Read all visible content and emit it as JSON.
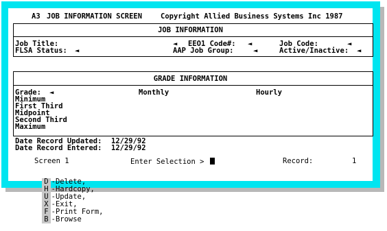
{
  "header": {
    "screen_code": "A3",
    "title": "JOB INFORMATION SCREEN",
    "copyright": "Copyright Allied Business Systems Inc 1987"
  },
  "job_section": {
    "heading": "JOB INFORMATION",
    "job_title_label": "Job Title:",
    "eeo1_label": "EEO1 Code#:",
    "job_code_label": "Job Code:",
    "flsa_label": "FLSA Status:",
    "aap_label": "AAP Job Group:",
    "active_label": "Active/Inactive:",
    "marker": "◄"
  },
  "grade_section": {
    "heading": "GRADE INFORMATION",
    "grade_label": "Grade:",
    "monthly_header": "Monthly",
    "hourly_header": "Hourly",
    "rows": [
      "Minimum",
      "First Third",
      "Midpoint",
      "Second Third",
      "Maximum"
    ]
  },
  "dates": {
    "updated_label": "Date Record Updated:",
    "updated_value": "12/29/92",
    "entered_label": "Date Record Entered:",
    "entered_value": "12/29/92"
  },
  "status": {
    "screen_label": "Screen 1",
    "prompt": "Enter Selection >",
    "record_label": "Record:",
    "record_value": "1"
  },
  "commands": [
    {
      "key": "D",
      "label": "-Delete,"
    },
    {
      "key": "H",
      "label": "-Hardcopy,"
    },
    {
      "key": "U",
      "label": "-Update,"
    },
    {
      "key": "X",
      "label": "-Exit,"
    },
    {
      "key": "F",
      "label": "-Print Form,"
    },
    {
      "key": "B",
      "label": "-Browse"
    }
  ],
  "colors": {
    "frame": "#00e5f0",
    "key_bg": "#c8c8c8",
    "shadow": "#b8b8b8"
  }
}
